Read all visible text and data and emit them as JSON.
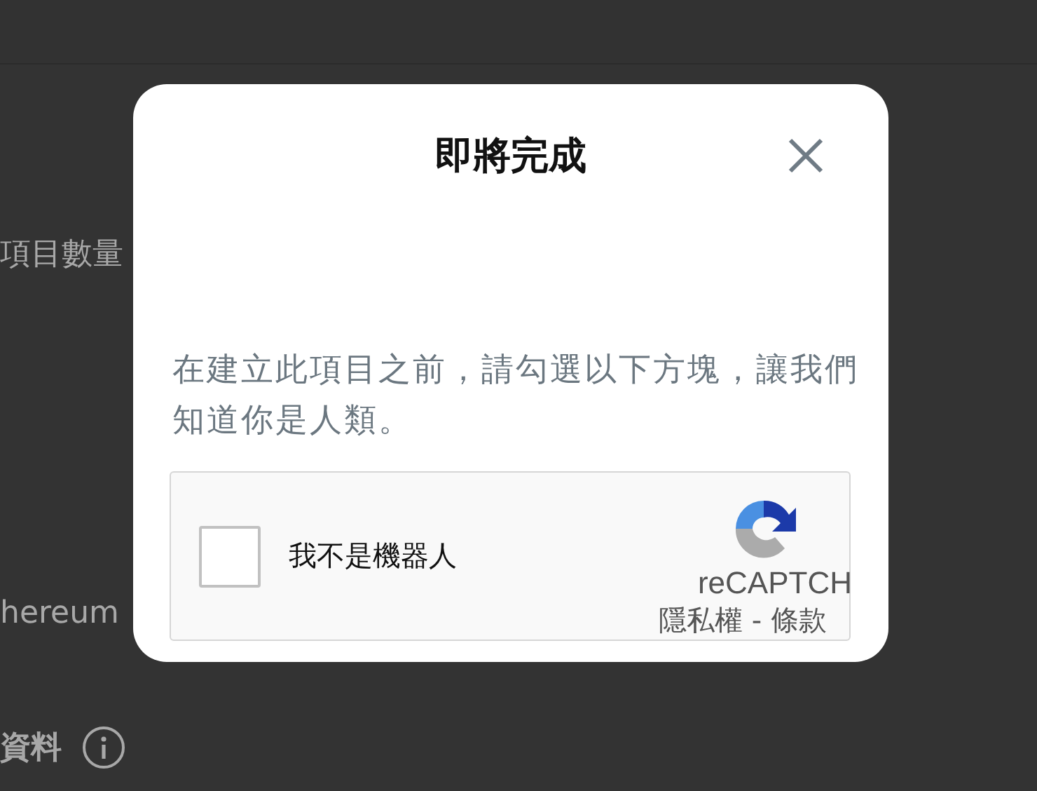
{
  "background": {
    "rows": [
      {
        "kind": "text",
        "text": "項目數量"
      },
      {
        "kind": "text",
        "text": "hereum"
      },
      {
        "kind": "heading",
        "text": "資料"
      }
    ]
  },
  "dialog": {
    "title": "即將完成",
    "message": "在建立此項目之前，請勾選以下方塊，讓我們知道你是人類。",
    "captcha": {
      "label": "我不是機器人",
      "checked": false,
      "brand": "reCAPTCH",
      "links": "隱私權 - 條款"
    }
  }
}
